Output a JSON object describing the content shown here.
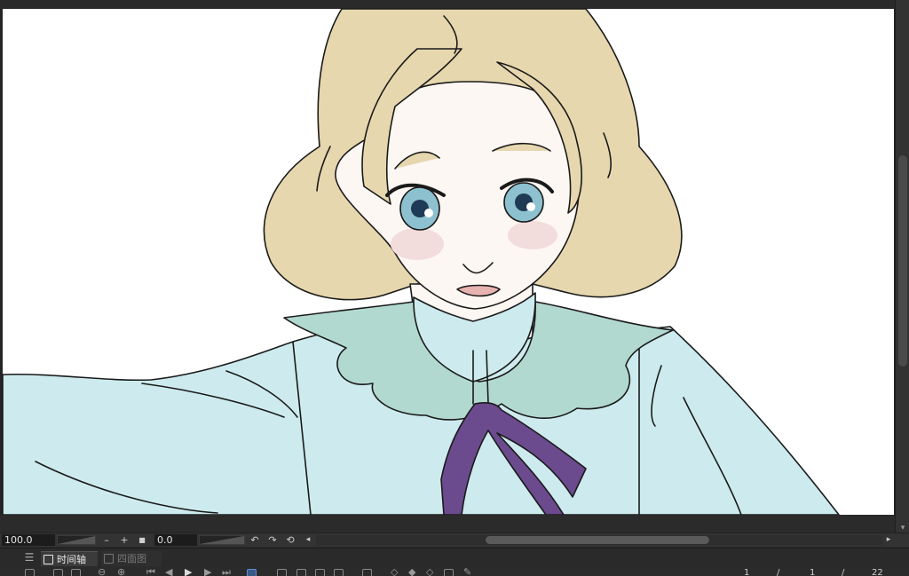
{
  "canvas": {
    "illustration_icon": "illustration-canvas"
  },
  "status_bar": {
    "zoom_value": "100.0",
    "rotation_value": "0.0",
    "zoom_out_label": "–",
    "zoom_in_label": "+",
    "stop_label": "■",
    "icons": [
      "rotate-left-icon",
      "rotate-right-icon",
      "reset-rotation-icon",
      "scroll-left-icon",
      "scroll-right-icon"
    ]
  },
  "timeline": {
    "menu_icon": "hamburger-menu-icon",
    "tabs": [
      {
        "label": "时间轴",
        "active": true
      },
      {
        "label": "四面图",
        "active": false
      }
    ],
    "frame_numbers": [
      "1",
      "/",
      "1",
      "/",
      "22"
    ]
  },
  "colors": {
    "hair": "#e6d7ae",
    "skin": "#fdf7f3",
    "shirt": "#cdebee",
    "collar": "#b2d9cf",
    "ribbon": "#6b4a8e",
    "eyes": "#8dc1cf",
    "panel_bg": "#2b2b2b"
  }
}
